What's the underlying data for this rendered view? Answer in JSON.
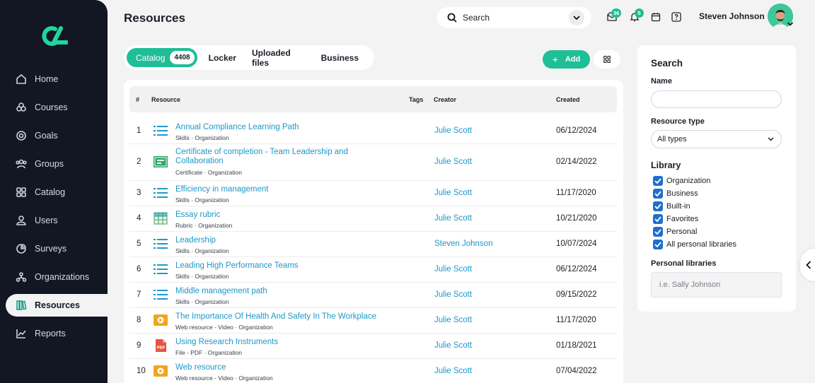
{
  "app": {
    "page_title": "Resources"
  },
  "sidebar": {
    "items": [
      {
        "label": "Home",
        "icon": "home-icon"
      },
      {
        "label": "Courses",
        "icon": "courses-icon"
      },
      {
        "label": "Goals",
        "icon": "goals-icon"
      },
      {
        "label": "Groups",
        "icon": "groups-icon"
      },
      {
        "label": "Catalog",
        "icon": "catalog-icon"
      },
      {
        "label": "Users",
        "icon": "user-icon"
      },
      {
        "label": "Surveys",
        "icon": "surveys-icon"
      },
      {
        "label": "Organizations",
        "icon": "organizations-icon"
      },
      {
        "label": "Resources",
        "icon": "resources-icon",
        "active": true
      },
      {
        "label": "Reports",
        "icon": "reports-icon"
      }
    ]
  },
  "header": {
    "search_label": "Search",
    "messages_count": "36",
    "notifications_count": "5",
    "user_name": "Steven Johnson"
  },
  "tabs": [
    {
      "label": "Catalog",
      "count": "4408",
      "active": true
    },
    {
      "label": "Locker"
    },
    {
      "label": "Uploaded files"
    },
    {
      "label": "Business"
    }
  ],
  "toolbar": {
    "add_label": "Add"
  },
  "table": {
    "columns": {
      "num": "#",
      "resource": "Resource",
      "tags": "Tags",
      "creator": "Creator",
      "created": "Created"
    },
    "rows": [
      {
        "num": "1",
        "title": "Annual Compliance Learning Path",
        "sub": "Skills · Organization",
        "creator": "Julie Scott",
        "created": "06/12/2024",
        "icon": "list-icon"
      },
      {
        "num": "2",
        "title": "Certificate of completion - Team Leadership and Collaboration",
        "sub": "Certificate · Organization",
        "creator": "Julie Scott",
        "created": "02/14/2022",
        "icon": "certificate-icon"
      },
      {
        "num": "3",
        "title": "Efficiency in management",
        "sub": "Skills · Organization",
        "creator": "Julie Scott",
        "created": "11/17/2020",
        "icon": "list-icon"
      },
      {
        "num": "4",
        "title": "Essay rubric",
        "sub": "Rubric · Organization",
        "creator": "Julie Scott",
        "created": "10/21/2020",
        "icon": "rubric-icon"
      },
      {
        "num": "5",
        "title": "Leadership",
        "sub": "Skills · Organization",
        "creator": "Steven Johnson",
        "created": "10/07/2024",
        "icon": "list-icon"
      },
      {
        "num": "6",
        "title": "Leading High Performance Teams",
        "sub": "Skills · Organization",
        "creator": "Julie Scott",
        "created": "06/12/2024",
        "icon": "list-icon"
      },
      {
        "num": "7",
        "title": "Middle management path",
        "sub": "Skills · Organization",
        "creator": "Julie Scott",
        "created": "09/15/2022",
        "icon": "list-icon"
      },
      {
        "num": "8",
        "title": "The Importance Of Health And Safety In The Workplace",
        "sub": "Web resource - Video · Organization",
        "creator": "Julie Scott",
        "created": "11/17/2020",
        "icon": "video-icon"
      },
      {
        "num": "9",
        "title": "Using Research Instruments",
        "sub": "File - PDF · Organization",
        "creator": "Julie Scott",
        "created": "01/18/2021",
        "icon": "pdf-icon"
      },
      {
        "num": "10",
        "title": "Web resource",
        "sub": "Web resource - Video · Organization",
        "creator": "Julie Scott",
        "created": "07/04/2022",
        "icon": "video-icon"
      }
    ]
  },
  "filters": {
    "heading": "Search",
    "name_label": "Name",
    "type_label": "Resource type",
    "type_value": "All types",
    "library_label": "Library",
    "libraries": [
      "Organization",
      "Business",
      "Built-in",
      "Favorites",
      "Personal",
      "All personal libraries"
    ],
    "personal_label": "Personal libraries",
    "personal_placeholder": "i.e. Sally Johnson"
  },
  "colors": {
    "accent": "#1fbe96",
    "link": "#1f97c9",
    "sidebar": "#121723",
    "checkbox": "#1f6fcf"
  }
}
